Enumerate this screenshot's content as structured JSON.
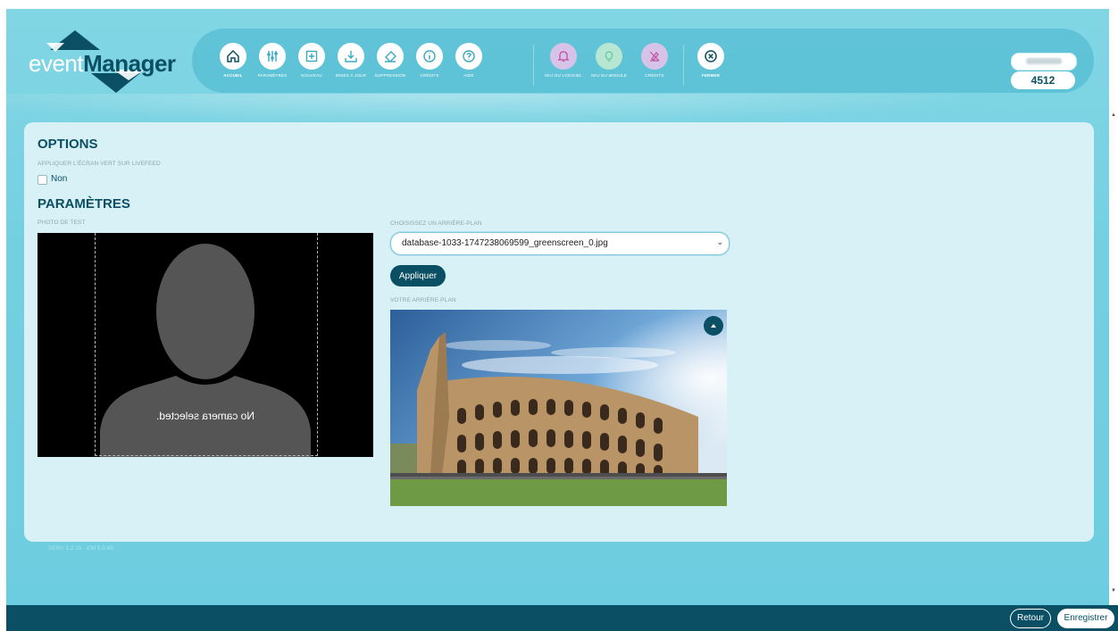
{
  "app": {
    "logo_prefix": "event",
    "logo_suffix": "Manager",
    "user_code": "4512",
    "version": "SERV 1.2.13 - EM 5.0.69"
  },
  "nav": {
    "items": [
      {
        "label": "ACCUEIL",
        "icon": "home-icon"
      },
      {
        "label": "PARAMÈTRES",
        "icon": "sliders-icon"
      },
      {
        "label": "NOUVEAU",
        "icon": "plus-square-icon"
      },
      {
        "label": "MISES À JOUR",
        "icon": "update-icon"
      },
      {
        "label": "SUPPRESSION",
        "icon": "eraser-icon"
      },
      {
        "label": "CRÉDITS",
        "icon": "info-icon"
      },
      {
        "label": "AIDE",
        "icon": "help-icon"
      },
      {
        "label": "MAJ DU LOGICIEL",
        "icon": "bell-icon"
      },
      {
        "label": "MAJ DU MODULE",
        "icon": "bulb-icon"
      },
      {
        "label": "CRÉDITS",
        "icon": "credits-icon"
      },
      {
        "label": "FERMER",
        "icon": "close-circle-icon"
      }
    ]
  },
  "options": {
    "title": "OPTIONS",
    "greenscreen_label": "APPLIQUER L'ÉCRAN VERT SUR LIVEFEED",
    "greenscreen_value": "Non"
  },
  "settings": {
    "title": "PARAMÈTRES",
    "test_photo_label": "PHOTO DE TEST",
    "no_camera_text": "No camera selected.",
    "choose_bg_label": "CHOISISSEZ UN ARRIÈRE-PLAN",
    "selected_bg": "database-1033-1747238069599_greenscreen_0.jpg",
    "apply_label": "Appliquer",
    "your_bg_label": "VOTRE ARRIÈRE-PLAN"
  },
  "footer": {
    "back_label": "Retour",
    "save_label": "Enregistrer"
  },
  "colors": {
    "primary": "#0a4f63",
    "background": "#74d0e1",
    "panel": "#d7f1f6"
  }
}
